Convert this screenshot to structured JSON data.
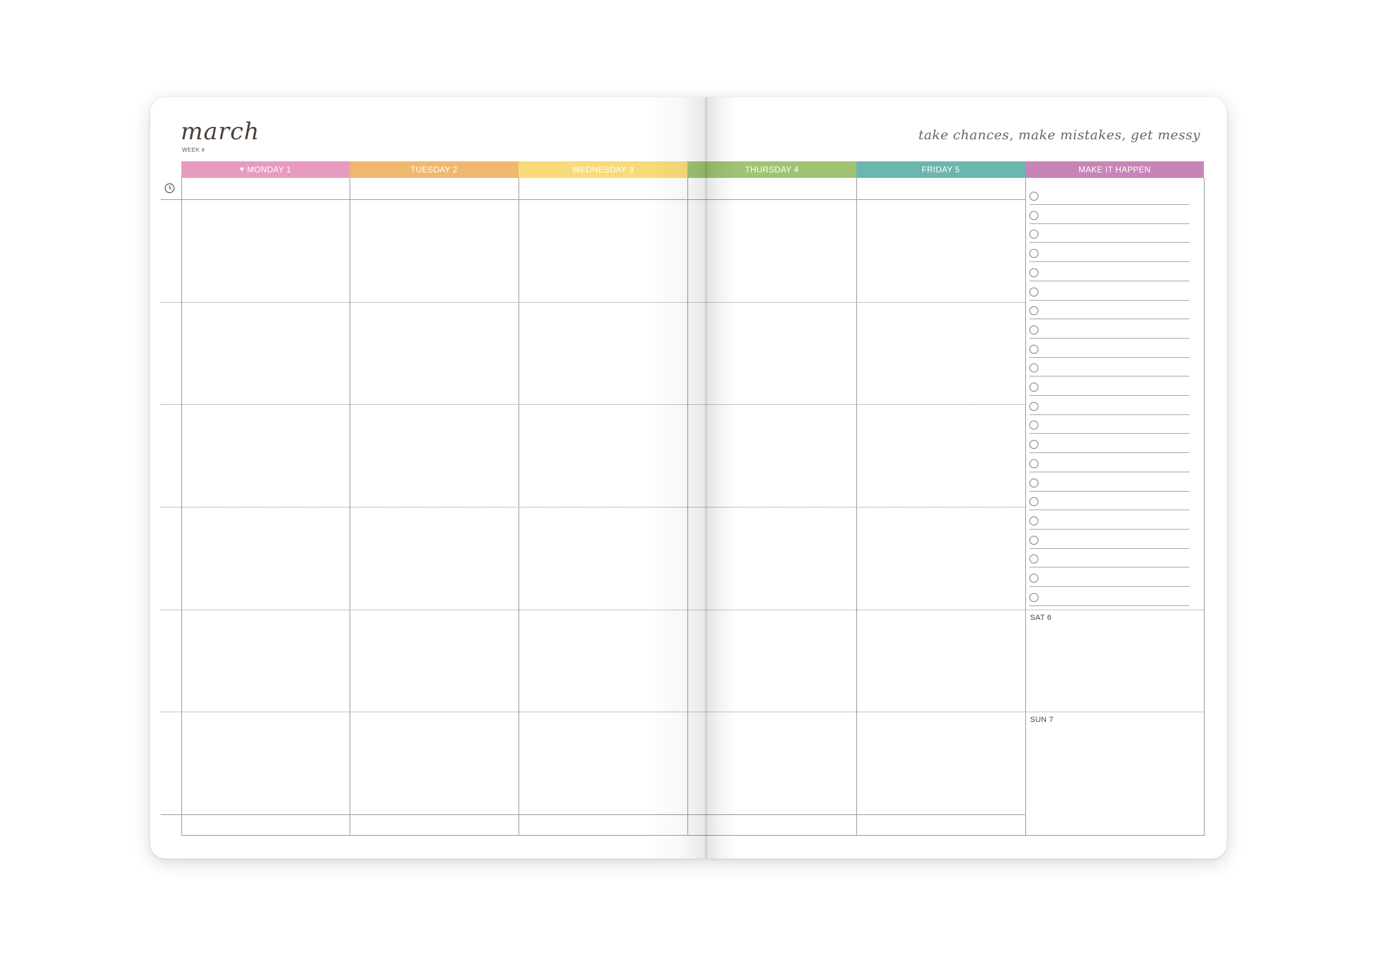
{
  "header": {
    "month": "march",
    "week_label": "WEEK #",
    "quote": "take chances, make mistakes, get messy"
  },
  "columns": [
    {
      "label": "MONDAY 1",
      "color": "#E79BC0",
      "heart": "♥"
    },
    {
      "label": "TUESDAY 2",
      "color": "#F0B86E"
    },
    {
      "label": "WEDNESDAY 3",
      "color": "#F8DA78"
    },
    {
      "label": "THURSDAY 4",
      "color": "#A0C473"
    },
    {
      "label": "FRIDAY 5",
      "color": "#6BB6AF"
    },
    {
      "label": "MAKE IT HAPPEN",
      "color": "#C785B7"
    }
  ],
  "weekend": {
    "sat": "SAT 6",
    "sun": "SUN 7"
  },
  "icons": {
    "time_column": "clock-icon",
    "todo": "checkbox-circle-icon",
    "monday_marker": "heart-icon"
  },
  "todo_count": 22
}
